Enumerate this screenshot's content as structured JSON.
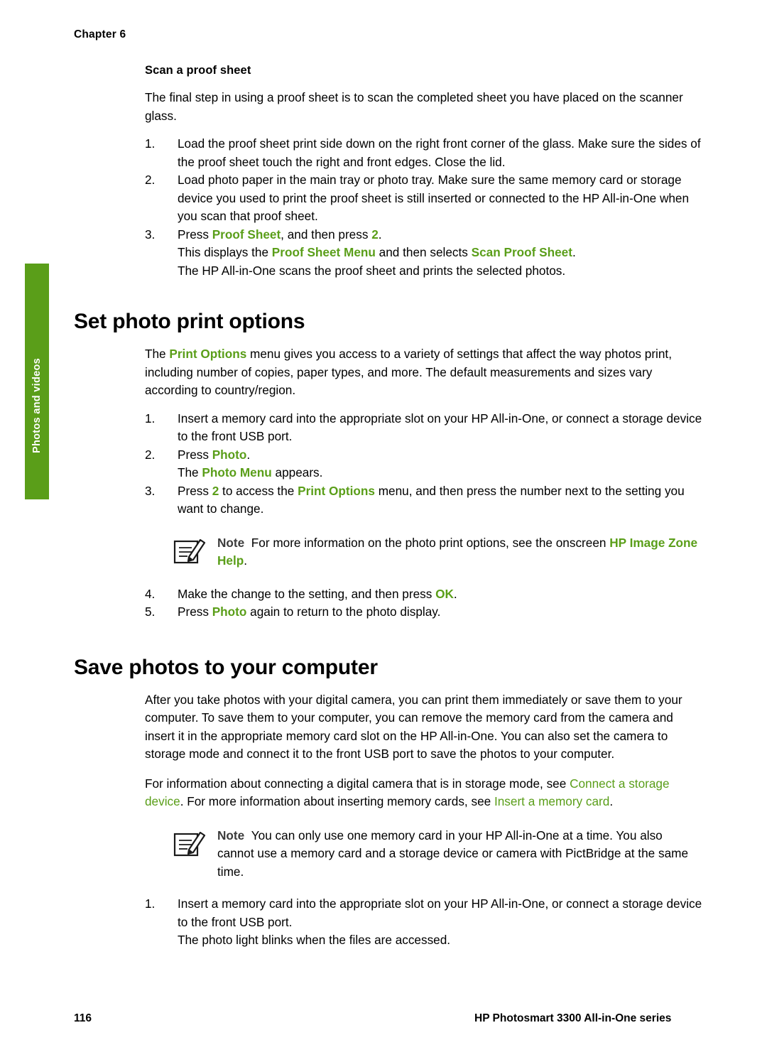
{
  "header": {
    "chapter_label": "Chapter 6"
  },
  "side_tab": {
    "label": "Photos and videos",
    "color": "#5a9e19"
  },
  "section1": {
    "subhead": "Scan a proof sheet",
    "intro": "The final step in using a proof sheet is to scan the completed sheet you have placed on the scanner glass.",
    "steps": [
      {
        "num": "1.",
        "text": "Load the proof sheet print side down on the right front corner of the glass. Make sure the sides of the proof sheet touch the right and front edges. Close the lid."
      },
      {
        "num": "2.",
        "text": "Load photo paper in the main tray or photo tray. Make sure the same memory card or storage device you used to print the proof sheet is still inserted or connected to the HP All-in-One when you scan that proof sheet."
      },
      {
        "num": "3.",
        "parts": [
          {
            "t": "Press ",
            "s": "plain"
          },
          {
            "t": "Proof Sheet",
            "s": "green"
          },
          {
            "t": ", and then press ",
            "s": "plain"
          },
          {
            "t": "2",
            "s": "green"
          },
          {
            "t": ".",
            "s": "plain"
          }
        ],
        "sub1": [
          {
            "t": "This displays the ",
            "s": "plain"
          },
          {
            "t": "Proof Sheet Menu",
            "s": "green"
          },
          {
            "t": " and then selects ",
            "s": "plain"
          },
          {
            "t": "Scan Proof Sheet",
            "s": "green"
          },
          {
            "t": ".",
            "s": "plain"
          }
        ],
        "sub2": [
          {
            "t": "The HP All-in-One scans the proof sheet and prints the selected photos.",
            "s": "plain"
          }
        ]
      }
    ]
  },
  "section2": {
    "heading": "Set photo print options",
    "intro_parts": [
      {
        "t": "The ",
        "s": "plain"
      },
      {
        "t": "Print Options",
        "s": "green"
      },
      {
        "t": " menu gives you access to a variety of settings that affect the way photos print, including number of copies, paper types, and more. The default measurements and sizes vary according to country/region.",
        "s": "plain"
      }
    ],
    "steps": [
      {
        "num": "1.",
        "text": "Insert a memory card into the appropriate slot on your HP All-in-One, or connect a storage device to the front USB port."
      },
      {
        "num": "2.",
        "parts": [
          {
            "t": "Press ",
            "s": "plain"
          },
          {
            "t": "Photo",
            "s": "green"
          },
          {
            "t": ".",
            "s": "plain"
          }
        ],
        "sub1": [
          {
            "t": "The ",
            "s": "plain"
          },
          {
            "t": "Photo Menu",
            "s": "green"
          },
          {
            "t": " appears.",
            "s": "plain"
          }
        ]
      },
      {
        "num": "3.",
        "parts": [
          {
            "t": "Press ",
            "s": "plain"
          },
          {
            "t": "2",
            "s": "green"
          },
          {
            "t": " to access the ",
            "s": "plain"
          },
          {
            "t": "Print Options",
            "s": "green"
          },
          {
            "t": " menu, and then press the number next to the setting you want to change.",
            "s": "plain"
          }
        ]
      }
    ],
    "note": {
      "label": "Note",
      "parts": [
        {
          "t": "For more information on the photo print options, see the onscreen ",
          "s": "plain"
        },
        {
          "t": "HP Image Zone Help",
          "s": "green"
        },
        {
          "t": ".",
          "s": "plain"
        }
      ],
      "icon": "note-pencil-icon"
    },
    "steps_after": [
      {
        "num": "4.",
        "parts": [
          {
            "t": "Make the change to the setting, and then press ",
            "s": "plain"
          },
          {
            "t": "OK",
            "s": "green"
          },
          {
            "t": ".",
            "s": "plain"
          }
        ]
      },
      {
        "num": "5.",
        "parts": [
          {
            "t": "Press ",
            "s": "plain"
          },
          {
            "t": "Photo",
            "s": "green"
          },
          {
            "t": " again to return to the photo display.",
            "s": "plain"
          }
        ]
      }
    ]
  },
  "section3": {
    "heading": "Save photos to your computer",
    "para1": "After you take photos with your digital camera, you can print them immediately or save them to your computer. To save them to your computer, you can remove the memory card from the camera and insert it in the appropriate memory card slot on the HP All-in-One. You can also set the camera to storage mode and connect it to the front USB port to save the photos to your computer.",
    "para2_parts": [
      {
        "t": "For information about connecting a digital camera that is in storage mode, see ",
        "s": "plain"
      },
      {
        "t": "Connect a storage device",
        "s": "link"
      },
      {
        "t": ". For more information about inserting memory cards, see ",
        "s": "plain"
      },
      {
        "t": "Insert a memory card",
        "s": "link"
      },
      {
        "t": ".",
        "s": "plain"
      }
    ],
    "note": {
      "label": "Note",
      "parts": [
        {
          "t": "You can only use one memory card in your HP All-in-One at a time. You also cannot use a memory card and a storage device or camera with PictBridge at the same time.",
          "s": "plain"
        }
      ],
      "icon": "note-pencil-icon"
    },
    "steps": [
      {
        "num": "1.",
        "text": "Insert a memory card into the appropriate slot on your HP All-in-One, or connect a storage device to the front USB port.",
        "sub1": [
          {
            "t": "The photo light blinks when the files are accessed.",
            "s": "plain"
          }
        ]
      }
    ]
  },
  "footer": {
    "page_number": "116",
    "product": "HP Photosmart 3300 All-in-One series"
  }
}
